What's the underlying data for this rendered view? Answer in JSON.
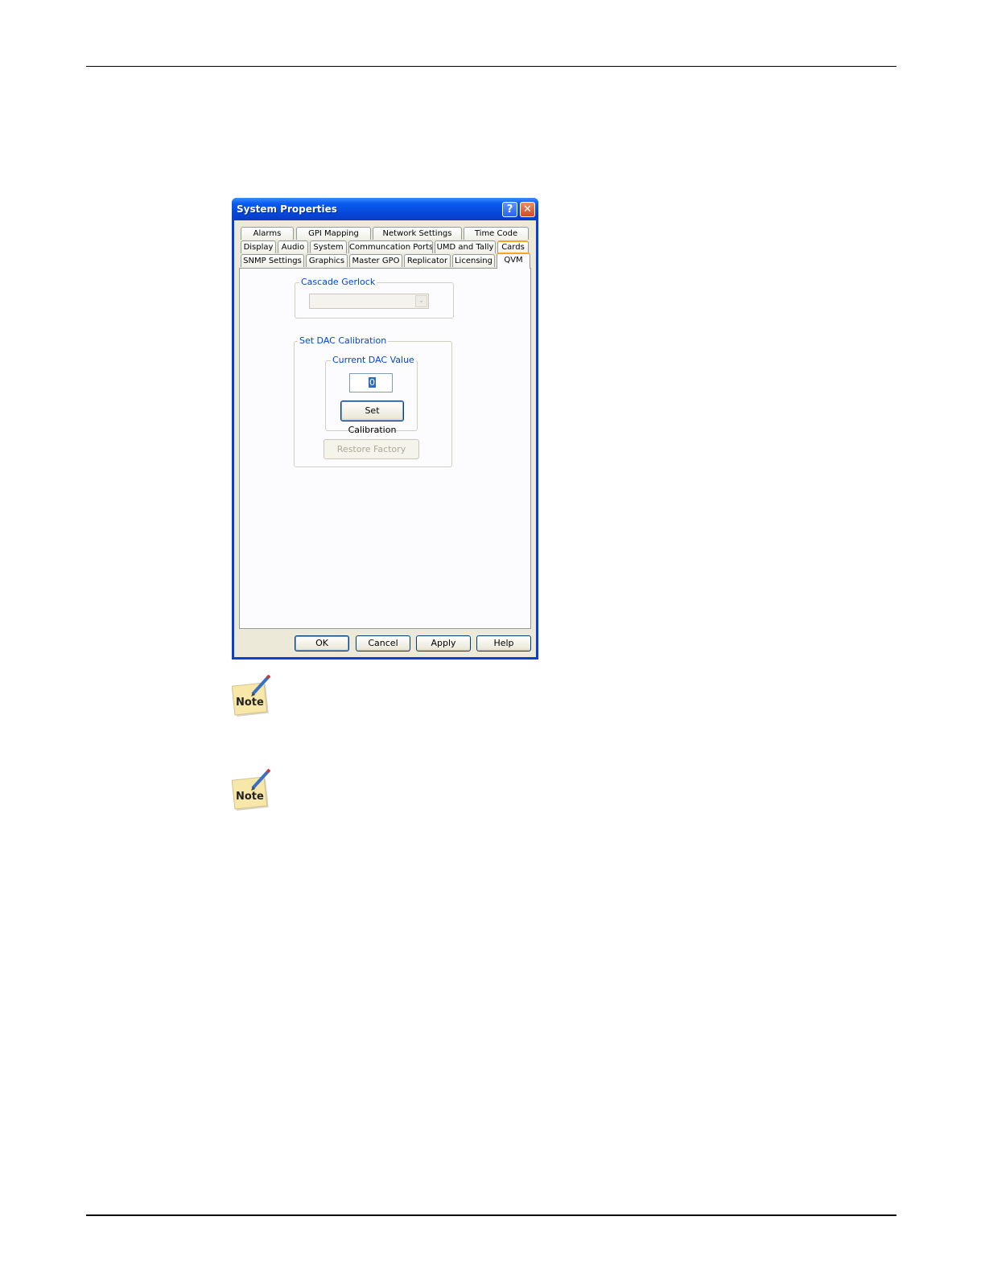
{
  "window": {
    "title": "System Properties",
    "help_glyph": "?",
    "close_glyph": "✕"
  },
  "tabs": {
    "row1": [
      "Alarms",
      "GPI Mapping",
      "Network Settings",
      "Time Code"
    ],
    "row2": [
      "Display",
      "Audio",
      "System",
      "Communcation Ports",
      "UMD and Tally",
      "Cards"
    ],
    "row3": [
      "SNMP Settings",
      "Graphics",
      "Master GPO",
      "Replicator",
      "Licensing",
      "QVM"
    ],
    "active": "QVM"
  },
  "cascade_gerlock": {
    "legend": "Cascade Gerlock",
    "value": ""
  },
  "dac": {
    "legend": "Set DAC Calibration",
    "current_legend": "Current DAC Value",
    "current_value": "0",
    "set_calibration_label": "Set Calibration",
    "restore_factory_label": "Restore Factory"
  },
  "buttons": {
    "ok": "OK",
    "cancel": "Cancel",
    "apply": "Apply",
    "help": "Help"
  },
  "notes": [
    "Note",
    "Note"
  ],
  "icons": [
    "help-icon",
    "close-icon",
    "dropdown-arrow-icon",
    "note-pencil-icon"
  ]
}
